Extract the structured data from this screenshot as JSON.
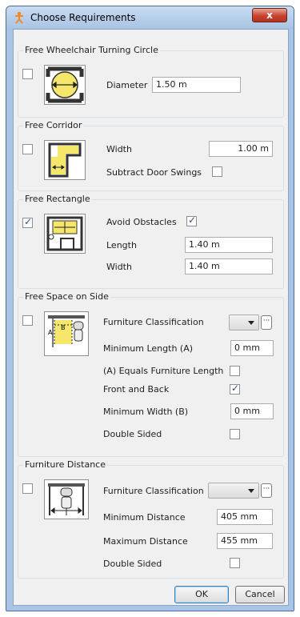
{
  "window": {
    "title": "Choose Requirements",
    "close_glyph": "x"
  },
  "turning_circle": {
    "title": "Free Wheelchair Turning Circle",
    "checked": false,
    "diameter_label": "Diameter",
    "diameter_value": "1.50 m"
  },
  "corridor": {
    "title": "Free Corridor",
    "checked": false,
    "width_label": "Width",
    "width_value": "1.00 m",
    "subtract_label": "Subtract Door Swings",
    "subtract_checked": false
  },
  "rectangle": {
    "title": "Free Rectangle",
    "checked": true,
    "avoid_label": "Avoid Obstacles",
    "avoid_checked": true,
    "length_label": "Length",
    "length_value": "1.40 m",
    "width_label": "Width",
    "width_value": "1.40 m",
    "icon_a": "A",
    "icon_b": "B"
  },
  "side_space": {
    "title": "Free Space on Side",
    "checked": false,
    "classification_label": "Furniture Classification",
    "classification_value": "",
    "min_length_label": "Minimum Length (A)",
    "min_length_value": "0 mm",
    "equals_label": "(A) Equals Furniture Length",
    "equals_checked": false,
    "front_back_label": "Front and Back",
    "front_back_checked": true,
    "min_width_label": "Minimum Width (B)",
    "min_width_value": "0 mm",
    "double_label": "Double Sided",
    "double_checked": false,
    "icon_a": "A",
    "icon_b": "B"
  },
  "distance": {
    "title": "Furniture Distance",
    "checked": false,
    "classification_label": "Furniture Classification",
    "classification_value": "",
    "min_label": "Minimum Distance",
    "min_value": "405 mm",
    "max_label": "Maximum Distance",
    "max_value": "455 mm",
    "double_label": "Double Sided",
    "double_checked": false
  },
  "buttons": {
    "ok": "OK",
    "cancel": "Cancel"
  },
  "colors": {
    "accent": "#f5e76b",
    "title_bg": "#a9c4e4",
    "close": "#c7432f",
    "check": "#2d4f8a"
  },
  "icons": [
    "accessibility-app-icon",
    "turning-circle-icon",
    "corridor-icon",
    "rectangle-icon",
    "side-space-icon",
    "furniture-distance-icon",
    "close-icon",
    "dropdown-arrow-icon",
    "ellipsis-icon"
  ]
}
